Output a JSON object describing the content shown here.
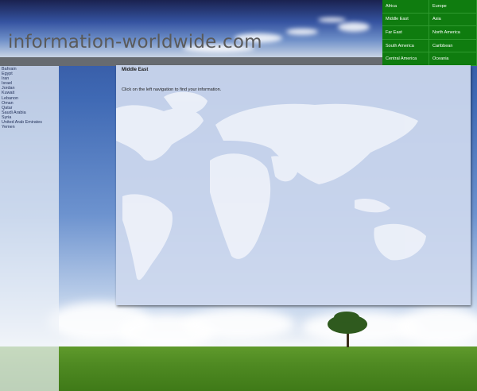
{
  "header": {
    "site_title": "information-worldwide.com"
  },
  "region_nav": [
    "Africa",
    "Europe",
    "Middle East",
    "Asia",
    "Far East",
    "North America",
    "South America",
    "Caribbean",
    "Central America",
    "Oceania"
  ],
  "sidebar": {
    "items": [
      "Bahrain",
      "Egypt",
      "Iran",
      "Israel",
      "Jordan",
      "Kuwait",
      "Lebanon",
      "Oman",
      "Qatar",
      "Saudi Arabia",
      "Syria",
      "United Arab Emirates",
      "Yemen"
    ]
  },
  "main": {
    "title": "Middle East",
    "instruction": "Click on the left navigation to find your information."
  },
  "colors": {
    "nav_green": "#0f7c0f",
    "header_bar": "#676b70"
  }
}
